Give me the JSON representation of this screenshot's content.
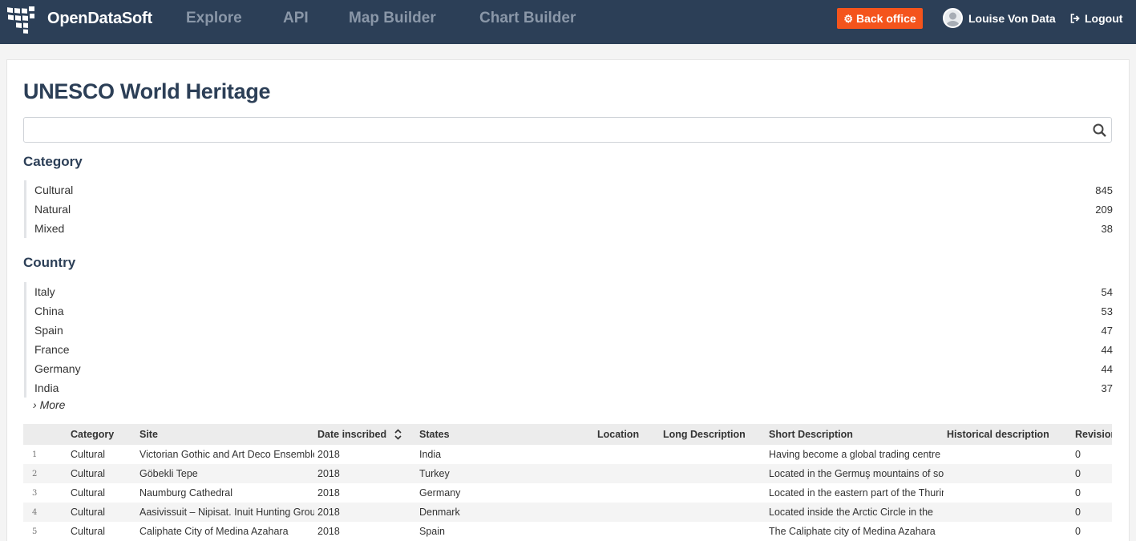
{
  "header": {
    "brand": "OpenDataSoft",
    "nav": [
      "Explore",
      "API",
      "Map Builder",
      "Chart Builder"
    ],
    "back_office": "Back office",
    "user": "Louise Von Data",
    "logout": "Logout"
  },
  "page": {
    "title": "UNESCO World Heritage",
    "search_value": "",
    "search_placeholder": ""
  },
  "facets": {
    "category": {
      "title": "Category",
      "items": [
        {
          "label": "Cultural",
          "count": "845"
        },
        {
          "label": "Natural",
          "count": "209"
        },
        {
          "label": "Mixed",
          "count": "38"
        }
      ]
    },
    "country": {
      "title": "Country",
      "items": [
        {
          "label": "Italy",
          "count": "54"
        },
        {
          "label": "China",
          "count": "53"
        },
        {
          "label": "Spain",
          "count": "47"
        },
        {
          "label": "France",
          "count": "44"
        },
        {
          "label": "Germany",
          "count": "44"
        },
        {
          "label": "India",
          "count": "37"
        }
      ],
      "more": "More"
    }
  },
  "table": {
    "columns": [
      "Category",
      "Site",
      "Date inscribed",
      "States",
      "Location",
      "Long Description",
      "Short Description",
      "Historical description",
      "Revision"
    ],
    "rows": [
      {
        "num": "1",
        "category": "Cultural",
        "site": "Victorian Gothic and Art Deco Ensembles of Mumbai",
        "date": "2018",
        "states": "India",
        "location": "",
        "long": "",
        "short": "Having become a global trading centre",
        "historical": "",
        "revision": "0"
      },
      {
        "num": "2",
        "category": "Cultural",
        "site": "Göbekli Tepe",
        "date": "2018",
        "states": "Turkey",
        "location": "",
        "long": "",
        "short": "Located in the Germuş mountains of south",
        "historical": "",
        "revision": "0"
      },
      {
        "num": "3",
        "category": "Cultural",
        "site": "Naumburg Cathedral",
        "date": "2018",
        "states": "Germany",
        "location": "",
        "long": "",
        "short": "Located in the eastern part of the Thuringian",
        "historical": "",
        "revision": "0"
      },
      {
        "num": "4",
        "category": "Cultural",
        "site": "Aasivissuit – Nipisat. Inuit Hunting Ground",
        "date": "2018",
        "states": "Denmark",
        "location": "",
        "long": "",
        "short": "Located inside the Arctic Circle in the",
        "historical": "",
        "revision": "0"
      },
      {
        "num": "5",
        "category": "Cultural",
        "site": "Caliphate City of Medina Azahara",
        "date": "2018",
        "states": "Spain",
        "location": "",
        "long": "",
        "short": "The Caliphate city of Medina Azahara",
        "historical": "",
        "revision": "0"
      }
    ]
  },
  "colors": {
    "topbar": "#2c3f57",
    "accent": "#f4541c",
    "title": "#2c3f57"
  },
  "icons": [
    "logo-icon",
    "gear-icon",
    "avatar-icon",
    "logout-icon",
    "search-icon",
    "sort-icon",
    "chevron-right-icon"
  ]
}
